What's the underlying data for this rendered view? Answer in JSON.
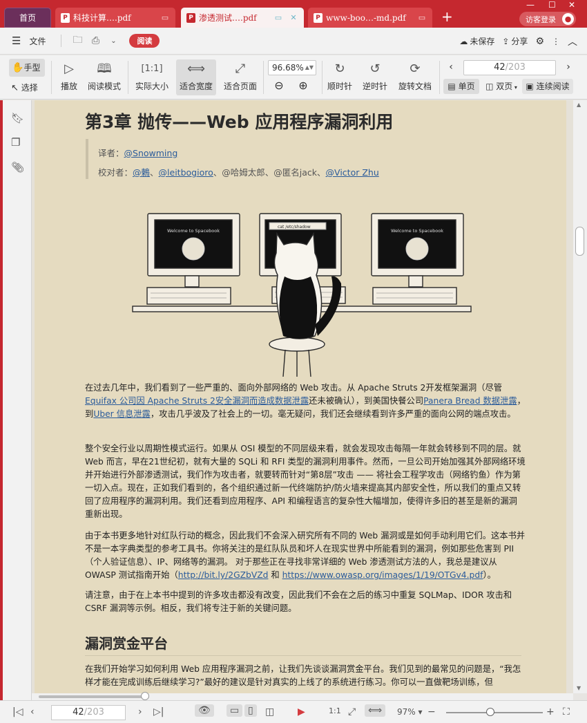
{
  "tabs": {
    "home": "首页",
    "doc1": "科技计算….pdf",
    "doc2": "渗透测试….pdf",
    "doc3": "www-boo…-md.pdf",
    "new_tab": "+"
  },
  "window": {
    "guest_label": "访客登录"
  },
  "menu": {
    "file": "文件",
    "read": "阅读",
    "unsaved": "未保存",
    "share": "分享"
  },
  "toolbar": {
    "hand": "手型",
    "select": "选择",
    "play": "播放",
    "read_mode": "阅读模式",
    "actual_size": "实际大小",
    "fit_width": "适合宽度",
    "fit_page": "适合页面",
    "zoom": "96.68%",
    "rotate_cw": "顺时针",
    "rotate_ccw": "逆时针",
    "rotate_doc": "旋转文档",
    "single_page": "单页",
    "double_page": "双页",
    "continuous": "连续阅读",
    "page_current": "42",
    "page_total": "/203"
  },
  "document": {
    "chapter_title": "第3章 抛传——Web 应用程序漏洞利用",
    "translator_label": "译者：",
    "translator": "@Snowming",
    "proofreader_label": "校对者：",
    "proofreaders": [
      "@鶇",
      "@leitbogioro",
      "@哈姆太郎",
      "@匿名jack",
      "@Victor Zhu"
    ],
    "illustration": {
      "screen_text_left": "Welcome to Spacebook",
      "screen_text_mid": "cat /etc/shadow",
      "screen_text_right": "Welcome to Spacebook"
    },
    "p1_a": "在过去几年中，我们看到了一些严重的、面向外部网络的 Web 攻击。从 Apache Struts 2开发框架漏洞（尽管",
    "p1_link1": "Equifax 公司因 Apache Struts 2安全漏洞而造成数据泄露",
    "p1_b": "还未被确认），到美国快餐公司",
    "p1_link2": "Panera Bread 数据泄露",
    "p1_c": "，到",
    "p1_link3": "Uber 信息泄露",
    "p1_d": "，攻击几乎波及了社会上的一切。毫无疑问，我们还会继续看到许多严重的面向公网的端点攻击。",
    "p2": "整个安全行业以周期性模式运行。如果从 OSI 模型的不同层级来看，就会发现攻击每隔一年就会转移到不同的层。就 Web 而言，早在21世纪初，就有大量的 SQLi 和 RFI 类型的漏洞利用事件。然而，一旦公司开始加强其外部网络环境并开始进行外部渗透测试，我们作为攻击者，就要转而针对“第8层”攻击 —— 将社会工程学攻击（网络钓鱼）作为第一切入点。现在，正如我们看到的，各个组织通过新一代终端防护/防火墙来提高其内部安全性，所以我们的重点又转回了应用程序的漏洞利用。我们还看到应用程序、API 和编程语言的复杂性大幅增加，使得许多旧的甚至是新的漏洞重新出现。",
    "p3_a": "由于本书更多地针对红队行动的概念，因此我们不会深入研究所有不同的 Web 漏洞或是如何手动利用它们。这本书并不是一本字典类型的参考工具书。你将关注的是红队队员和坏人在现实世界中所能看到的漏洞，例如那些危害到 PII（个人验证信息）、IP、网络等的漏洞。 对于那些正在寻找非常详细的 Web 渗透测试方法的人，我总是建议从 OWASP 测试指南开始（",
    "p3_link1": "http://bit.ly/2GZbVZd",
    "p3_b": " 和 ",
    "p3_link2": "https://www.owasp.org/images/1/19/OTGv4.pdf",
    "p3_c": "）。",
    "p4": "请注意，由于在上本书中提到的许多攻击都没有改变，因此我们不会在之后的练习中重复 SQLMap、IDOR 攻击和 CSRF 漏洞等示例。相反，我们将专注于新的关键问题。",
    "section_title": "漏洞赏金平台",
    "p5": "在我们开始学习如何利用 Web 应用程序漏洞之前，让我们先谈谈漏洞赏金平台。我们见到的最常见的问题是，“我怎样才能在完成训练后继续学习?”最好的建议是针对真实的上线了的系统进行练习。你可以一直做靶场训练，但"
  },
  "bottom": {
    "page_current": "42",
    "page_total": "/203",
    "zoom": "97%"
  },
  "colors": {
    "brand": "#c5282f",
    "page_bg": "#e5dbc0",
    "link": "#2a5b9a"
  }
}
